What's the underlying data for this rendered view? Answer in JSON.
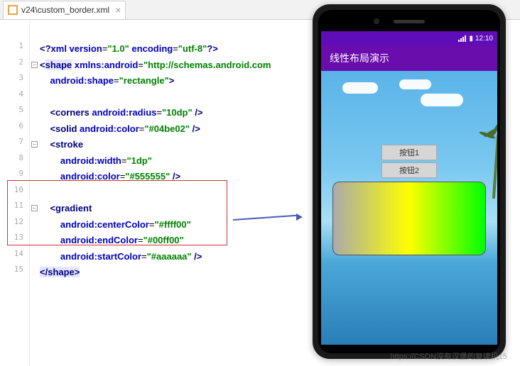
{
  "tab": {
    "filename": "v24\\custom_border.xml"
  },
  "lines": [
    "1",
    "2",
    "3",
    "4",
    "5",
    "6",
    "7",
    "8",
    "9",
    "10",
    "11",
    "12",
    "13",
    "14",
    "15"
  ],
  "code": {
    "l1": {
      "p1": "<?",
      "p2": "xml version",
      "p3": "=",
      "p4": "\"1.0\"",
      "p5": " encoding",
      "p6": "=",
      "p7": "\"utf-8\"",
      "p8": "?>"
    },
    "l2": {
      "p1": "<",
      "p2": "shape",
      "p3": " xmlns:",
      "p4": "android",
      "p5": "=",
      "p6": "\"http://schemas.android.com"
    },
    "l3": {
      "p1": "android:",
      "p2": "shape",
      "p3": "=",
      "p4": "\"rectangle\"",
      "p5": ">"
    },
    "l5": {
      "p1": "<",
      "p2": "corners",
      "p3": " android:",
      "p4": "radius",
      "p5": "=",
      "p6": "\"10dp\"",
      "p7": " />"
    },
    "l6": {
      "p1": "<",
      "p2": "solid",
      "p3": " android:",
      "p4": "color",
      "p5": "=",
      "p6": "\"#04be02\"",
      "p7": " />"
    },
    "l7": {
      "p1": "<",
      "p2": "stroke"
    },
    "l8": {
      "p1": "android:",
      "p2": "width",
      "p3": "=",
      "p4": "\"1dp\""
    },
    "l9": {
      "p1": "android:",
      "p2": "color",
      "p3": "=",
      "p4": "\"#555555\"",
      "p5": " />"
    },
    "l11": {
      "p1": "<",
      "p2": "gradient"
    },
    "l12": {
      "p1": "android:",
      "p2": "centerColor",
      "p3": "=",
      "p4": "\"#ffff00\""
    },
    "l13": {
      "p1": "android:",
      "p2": "endColor",
      "p3": "=",
      "p4": "\"#00ff00\""
    },
    "l14": {
      "p1": "android:",
      "p2": "startColor",
      "p3": "=",
      "p4": "\"#aaaaaa\"",
      "p5": " />"
    },
    "l15": {
      "p1": "</",
      "p2": "shape",
      "p3": ">"
    }
  },
  "phone": {
    "time": "12:10",
    "app_title": "线性布局演示",
    "btn1": "按钮1",
    "btn2": "按钮2"
  },
  "watermark": "https://CSDN沒有汉堡的复读机15"
}
